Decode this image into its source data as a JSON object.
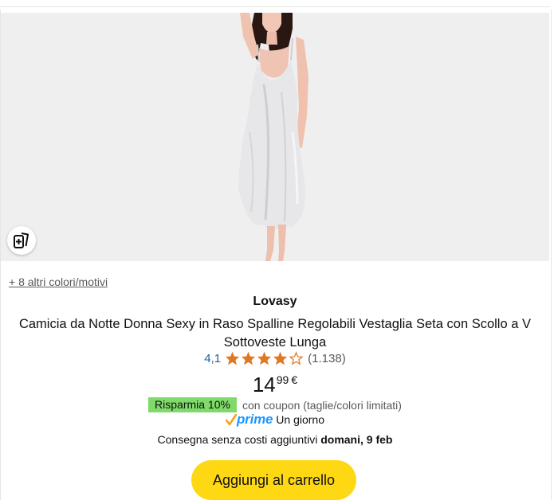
{
  "product": {
    "more_colors_link": "+ 8 altri colori/motivi",
    "brand": "Lovasy",
    "title": "Camicia da Notte Donna Sexy in Raso Spalline Regolabili Vestaglia Seta con Scollo a V Sottoveste Lunga",
    "rating": {
      "value": "4,1",
      "stars": 4.1,
      "count": "(1.138)"
    },
    "price": {
      "whole": "14",
      "fraction": "99",
      "currency": "€"
    },
    "coupon": {
      "badge": "Risparmia 10%",
      "text": "con coupon (taglie/colori limitati)"
    },
    "prime": {
      "logo_text": "prime",
      "delivery": "Un giorno"
    },
    "delivery": {
      "prefix": "Consegna senza costi aggiuntivi",
      "date": "domani, 9 feb"
    },
    "add_to_cart_label": "Aggiungi al carrello"
  },
  "icons": {
    "compare": "compare-cards-icon",
    "star_full": "star-full-icon",
    "star_empty": "star-empty-icon",
    "prime_check": "prime-check-icon"
  },
  "colors": {
    "star": "#de7921",
    "rating_link": "#2162a1",
    "coupon_badge": "#7fda69",
    "prime_blue": "#1a98ff",
    "cart_button": "#ffd814",
    "image_bg": "#efeff0"
  }
}
